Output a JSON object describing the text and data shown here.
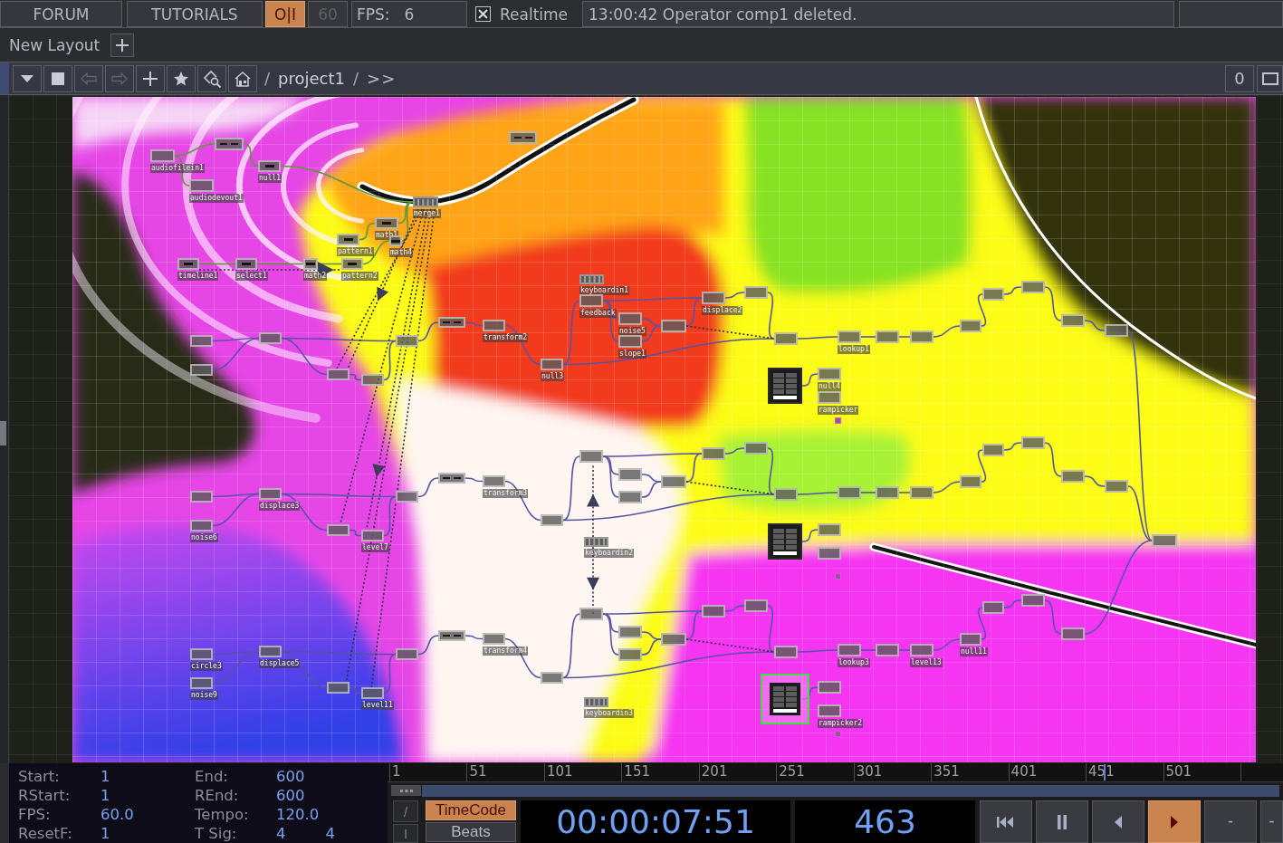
{
  "top_bar": {
    "links": [
      "FORUM",
      "TUTORIALS"
    ],
    "perform_toggle": {
      "label": "O|I",
      "on": true
    },
    "fps_limit": {
      "value": "60",
      "disabled": true
    },
    "fps": {
      "label": "FPS:",
      "value": "6"
    },
    "realtime": {
      "label": "Realtime",
      "checked": true
    },
    "message": "13:00:42 Operator comp1 deleted."
  },
  "layout_bar": {
    "title": "New Layout"
  },
  "network_toolbar": {
    "buttons": [
      {
        "kind": "menu",
        "disabled": false
      },
      {
        "kind": "stop",
        "disabled": false
      },
      {
        "kind": "back",
        "disabled": true
      },
      {
        "kind": "forward",
        "disabled": true
      },
      {
        "kind": "add",
        "disabled": false
      },
      {
        "kind": "favorite",
        "disabled": false
      },
      {
        "kind": "find",
        "disabled": false
      },
      {
        "kind": "home",
        "disabled": false
      }
    ],
    "path": [
      {
        "kind": "separator",
        "text": "/"
      },
      {
        "kind": "link",
        "text": "project1"
      },
      {
        "kind": "separator",
        "text": "/"
      },
      {
        "kind": "more",
        "text": ">>"
      }
    ],
    "counter": "0"
  },
  "network": {
    "nodes": [
      {
        "kind": "top",
        "label": "audiofilein1",
        "selected": false
      },
      {
        "kind": "comp",
        "selected": false
      },
      {
        "kind": "top",
        "label": "audiodevout1",
        "selected": false
      },
      {
        "kind": "chop",
        "label": "null1",
        "selected": false
      },
      {
        "kind": "comp",
        "selected": false
      },
      {
        "kind": "bars",
        "label": "merge1",
        "selected": false
      },
      {
        "kind": "chop",
        "label": "math1",
        "selected": false
      },
      {
        "kind": "chop",
        "label": "pattern1",
        "selected": false
      },
      {
        "kind": "chop",
        "label": "math4",
        "selected": false
      },
      {
        "kind": "chop",
        "label": "timeline1",
        "selected": false
      },
      {
        "kind": "chop",
        "label": "select1",
        "selected": false
      },
      {
        "kind": "chop",
        "label": "math2",
        "selected": false
      },
      {
        "kind": "chop",
        "label": "pattern2",
        "selected": false
      },
      {
        "kind": "top",
        "selected": false
      },
      {
        "kind": "top",
        "selected": false
      },
      {
        "kind": "top",
        "selected": false
      },
      {
        "kind": "top",
        "selected": false
      },
      {
        "kind": "top",
        "selected": false
      },
      {
        "kind": "top",
        "selected": false
      },
      {
        "kind": "comp",
        "selected": false
      },
      {
        "kind": "top",
        "label": "transform2",
        "selected": false
      },
      {
        "kind": "top",
        "label": "null3",
        "selected": false
      },
      {
        "kind": "bars",
        "label": "keyboardin1",
        "selected": false
      },
      {
        "kind": "top",
        "label": "feedback",
        "selected": false
      },
      {
        "kind": "top",
        "label": "noise5",
        "selected": false
      },
      {
        "kind": "top",
        "label": "slope1",
        "selected": false
      },
      {
        "kind": "top",
        "selected": false
      },
      {
        "kind": "top",
        "label": "displace2",
        "selected": false
      },
      {
        "kind": "top",
        "selected": false
      },
      {
        "kind": "top",
        "selected": false
      },
      {
        "kind": "top",
        "label": "lookup1",
        "selected": false
      },
      {
        "kind": "top",
        "selected": false
      },
      {
        "kind": "top",
        "selected": false
      },
      {
        "kind": "top",
        "selected": false
      },
      {
        "kind": "top",
        "selected": false
      },
      {
        "kind": "top",
        "selected": false
      },
      {
        "kind": "top",
        "selected": false
      },
      {
        "kind": "top",
        "selected": false
      },
      {
        "kind": "palette",
        "selected": false
      },
      {
        "kind": "top",
        "label": "null4",
        "selected": false
      },
      {
        "kind": "top",
        "label": "rampicker",
        "selected": false
      },
      {
        "kind": "marker",
        "selected": false
      },
      {
        "kind": "top",
        "selected": false
      },
      {
        "kind": "top",
        "label": "noise6",
        "selected": false
      },
      {
        "kind": "top",
        "label": "displace3",
        "selected": false
      },
      {
        "kind": "top",
        "selected": false
      },
      {
        "kind": "top",
        "label": "level7",
        "selected": false
      },
      {
        "kind": "top",
        "selected": false
      },
      {
        "kind": "comp",
        "selected": false
      },
      {
        "kind": "top",
        "label": "transform3",
        "selected": false
      },
      {
        "kind": "top",
        "selected": false
      },
      {
        "kind": "bars",
        "label": "keyboardin2",
        "selected": false
      },
      {
        "kind": "top",
        "selected": false
      },
      {
        "kind": "top",
        "selected": false
      },
      {
        "kind": "top",
        "selected": false
      },
      {
        "kind": "top",
        "selected": false
      },
      {
        "kind": "top",
        "selected": false
      },
      {
        "kind": "top",
        "selected": false
      },
      {
        "kind": "top",
        "selected": false
      },
      {
        "kind": "top",
        "selected": false
      },
      {
        "kind": "top",
        "selected": false
      },
      {
        "kind": "top",
        "selected": false
      },
      {
        "kind": "top",
        "selected": false
      },
      {
        "kind": "top",
        "selected": false
      },
      {
        "kind": "top",
        "selected": false
      },
      {
        "kind": "top",
        "selected": false
      },
      {
        "kind": "top",
        "selected": false
      },
      {
        "kind": "palette",
        "selected": false
      },
      {
        "kind": "top",
        "selected": false
      },
      {
        "kind": "top",
        "selected": false
      },
      {
        "kind": "marker",
        "selected": false
      },
      {
        "kind": "top",
        "label": "circle3",
        "selected": false
      },
      {
        "kind": "top",
        "label": "noise9",
        "selected": false
      },
      {
        "kind": "top",
        "label": "displace5",
        "selected": false
      },
      {
        "kind": "top",
        "selected": false
      },
      {
        "kind": "top",
        "label": "level11",
        "selected": false
      },
      {
        "kind": "top",
        "selected": false
      },
      {
        "kind": "comp",
        "selected": false
      },
      {
        "kind": "top",
        "label": "transform4",
        "selected": false
      },
      {
        "kind": "top",
        "selected": false
      },
      {
        "kind": "bars",
        "label": "keyboardin3",
        "selected": false
      },
      {
        "kind": "top",
        "selected": false
      },
      {
        "kind": "top",
        "selected": false
      },
      {
        "kind": "top",
        "selected": false
      },
      {
        "kind": "top",
        "selected": false
      },
      {
        "kind": "top",
        "selected": false
      },
      {
        "kind": "top",
        "selected": false
      },
      {
        "kind": "top",
        "selected": false
      },
      {
        "kind": "top",
        "label": "lookup3",
        "selected": false
      },
      {
        "kind": "top",
        "selected": false
      },
      {
        "kind": "top",
        "label": "level13",
        "selected": false
      },
      {
        "kind": "top",
        "label": "null11",
        "selected": false
      },
      {
        "kind": "top",
        "selected": false
      },
      {
        "kind": "top",
        "selected": false
      },
      {
        "kind": "top",
        "selected": false
      },
      {
        "kind": "palette",
        "selected": true
      },
      {
        "kind": "top",
        "selected": false
      },
      {
        "kind": "top",
        "label": "rampicker2",
        "selected": false
      },
      {
        "kind": "marker",
        "selected": false
      },
      {
        "kind": "top",
        "selected": false
      }
    ]
  },
  "timeline": {
    "settings": [
      {
        "label": "Start:",
        "values": [
          "1"
        ]
      },
      {
        "label": "End:",
        "values": [
          "600"
        ]
      },
      {
        "label": "RStart:",
        "values": [
          "1"
        ]
      },
      {
        "label": "REnd:",
        "values": [
          "600"
        ]
      },
      {
        "label": "FPS:",
        "values": [
          "60.0"
        ]
      },
      {
        "label": "Tempo:",
        "values": [
          "120.0"
        ]
      },
      {
        "label": "ResetF:",
        "values": [
          "1"
        ]
      },
      {
        "label": "T Sig:",
        "values": [
          "4",
          "4"
        ]
      }
    ],
    "ticks": [
      "1",
      "51",
      "101",
      "151",
      "201",
      "251",
      "301",
      "351",
      "401",
      "451",
      "501"
    ],
    "playhead": {
      "level": 0.8
    },
    "side_buttons": [
      "/",
      "I"
    ],
    "modes": [
      {
        "label": "TimeCode",
        "selected": true
      },
      {
        "label": "Beats",
        "selected": false
      }
    ],
    "timecode": "00:00:07:51",
    "frame": "463",
    "transport": [
      {
        "kind": "skip_start",
        "selected": false
      },
      {
        "kind": "pause",
        "selected": false
      },
      {
        "kind": "step_back",
        "selected": false
      },
      {
        "kind": "play",
        "selected": true
      },
      {
        "kind": "step",
        "label": "-",
        "selected": false
      },
      {
        "kind": "step",
        "label": "-",
        "selected": false
      }
    ]
  }
}
